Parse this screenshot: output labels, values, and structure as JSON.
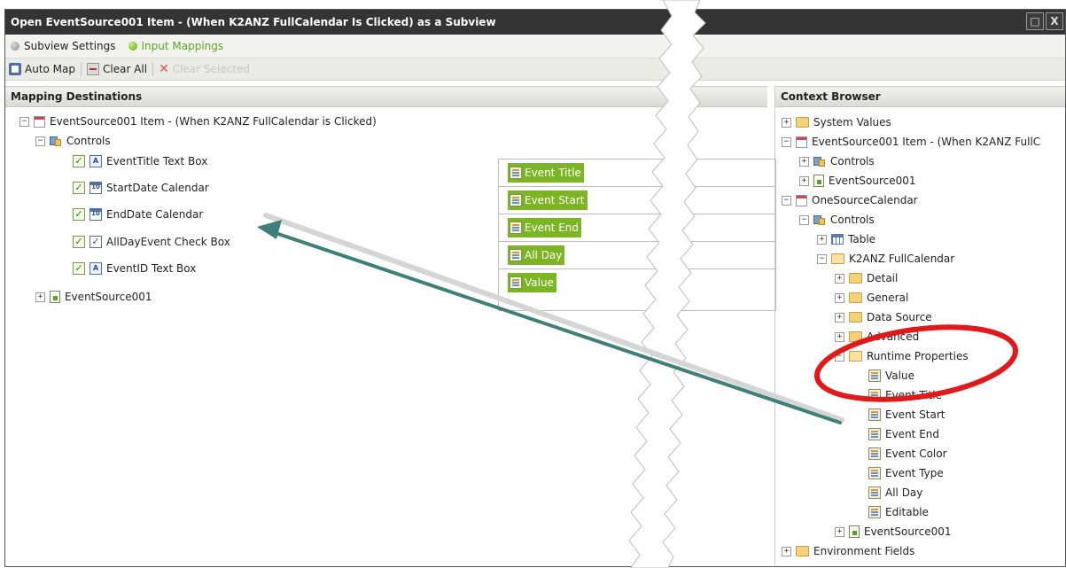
{
  "window": {
    "title": "Open EventSource001 Item - (When K2ANZ FullCalendar Is Clicked) as a Subview",
    "restore_glyph": "□",
    "close_glyph": "X"
  },
  "tabs": [
    {
      "label": "Subview Settings",
      "active": false
    },
    {
      "label": "Input Mappings",
      "active": true
    }
  ],
  "toolbar": {
    "auto_map": "Auto Map",
    "clear_all": "Clear All",
    "clear_selected": "Clear Selected"
  },
  "mapping": {
    "header": "Mapping Destinations",
    "root": "EventSource001 Item - (When K2ANZ FullCalendar is Clicked)",
    "controls": "Controls",
    "items": [
      {
        "label": "EventTitle Text Box",
        "icon_text": "A"
      },
      {
        "label": "StartDate Calendar",
        "icon_text": "10"
      },
      {
        "label": "EndDate Calendar",
        "icon_text": "10"
      },
      {
        "label": "AllDayEvent Check Box",
        "icon_text": "✓"
      },
      {
        "label": "EventID Text Box",
        "icon_text": "A"
      }
    ],
    "smo": "EventSource001",
    "mapped_values": [
      "Event Title",
      "Event Start",
      "Event End",
      "All Day",
      "Value"
    ]
  },
  "context": {
    "header": "Context Browser",
    "system_values": "System Values",
    "item": "EventSource001 Item - (When K2ANZ FullC",
    "item_controls": "Controls",
    "item_smo": "EventSource001",
    "view": "OneSourceCalendar",
    "view_controls": "Controls",
    "table": "Table",
    "calendar": "K2ANZ FullCalendar",
    "groups": [
      "Detail",
      "General",
      "Data Source",
      "Advanced"
    ],
    "runtime": "Runtime Properties",
    "runtime_props": [
      "Value",
      "Event Title",
      "Event Start",
      "Event End",
      "Event Color",
      "Event Type",
      "All Day",
      "Editable"
    ],
    "view_smo": "EventSource001",
    "environment": "Environment Fields"
  },
  "glyphs": {
    "plus": "+",
    "minus": "−",
    "check": "✓"
  },
  "colors": {
    "accent_green": "#7bb522",
    "annotation_red": "#e0191b",
    "arrow_teal": "#3f7f7a",
    "titlebar": "#343434"
  }
}
